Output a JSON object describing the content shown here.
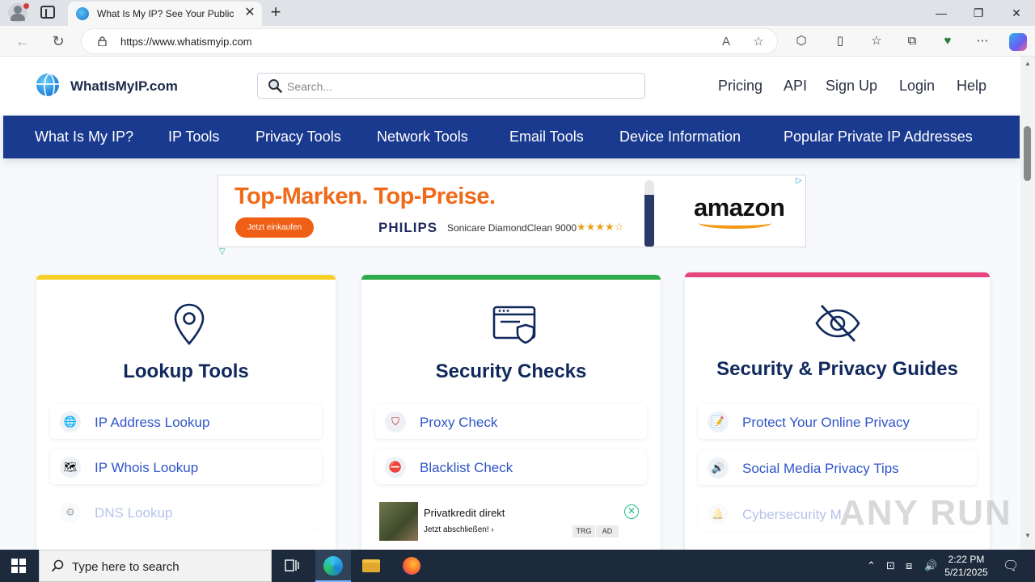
{
  "browser": {
    "tab_title": "What Is My IP? See Your Public IP",
    "url": "https://www.whatismyip.com",
    "window_minimize": "—",
    "window_maximize": "❐",
    "window_close": "✕"
  },
  "site": {
    "logo_text": "WhatIsMyIP.com",
    "search_placeholder": "Search...",
    "header_links": [
      "Pricing",
      "API",
      "Sign Up",
      "Login",
      "Help"
    ],
    "nav": [
      "What Is My IP?",
      "IP Tools",
      "Privacy Tools",
      "Network Tools",
      "Email Tools",
      "Device Information",
      "Popular Private IP Addresses"
    ]
  },
  "ad_top": {
    "headline": "Top-Marken. Top-Preise.",
    "cta": "Jetzt einkaufen",
    "brand": "PHILIPS",
    "product": "Sonicare DiamondClean 9000",
    "rating": "★★★★☆",
    "amazon": "amazon"
  },
  "cards": [
    {
      "title": "Lookup Tools",
      "accent": "#f6d026",
      "items": [
        {
          "label": "IP Address Lookup",
          "icon": "globe-icon"
        },
        {
          "label": "IP Whois Lookup",
          "icon": "map-icon"
        },
        {
          "label": "DNS Lookup",
          "icon": "dns-icon"
        }
      ]
    },
    {
      "title": "Security Checks",
      "accent": "#2eab4c",
      "items": [
        {
          "label": "Proxy Check",
          "icon": "shield-icon"
        },
        {
          "label": "Blacklist Check",
          "icon": "no-entry-icon"
        }
      ]
    },
    {
      "title": "Security & Privacy Guides",
      "accent": "#e8457f",
      "items": [
        {
          "label": "Protect Your Online Privacy",
          "icon": "note-icon"
        },
        {
          "label": "Social Media Privacy Tips",
          "icon": "speaker-icon"
        },
        {
          "label": "Cybersecurity M",
          "icon": "bell-icon"
        }
      ]
    }
  ],
  "ad_bottom": {
    "title": "Privatkredit direkt",
    "subtitle": "Jetzt abschließen!  ›",
    "tag1": "TRG",
    "tag2": "AD"
  },
  "watermark": "ANY RUN",
  "taskbar": {
    "search_placeholder": "Type here to search",
    "time": "2:22 PM",
    "date": "5/21/2025"
  },
  "colors": {
    "nav_bg": "#1a3a8f",
    "link_blue": "#2f55c8",
    "heading_navy": "#10285c"
  }
}
